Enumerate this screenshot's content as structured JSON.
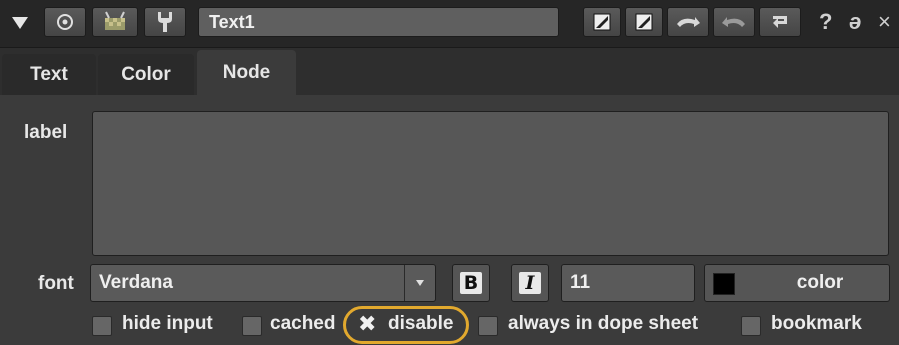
{
  "titlebar": {
    "node_name": "Text1",
    "icons": [
      "collapse-arrow-icon",
      "center-icon",
      "random-color-icon",
      "wrench-icon",
      "undo-icon",
      "redo-icon",
      "revert-icon",
      "help-icon",
      "float-icon",
      "close-icon"
    ],
    "help_glyph": "?",
    "float_glyph": "ə",
    "close_glyph": "×"
  },
  "tabs": [
    {
      "label": "Text",
      "active": false
    },
    {
      "label": "Color",
      "active": false
    },
    {
      "label": "Node",
      "active": true
    }
  ],
  "label_field": {
    "label": "label",
    "value": ""
  },
  "font_row": {
    "label": "font",
    "font_value": "Verdana",
    "bold_glyph": "B",
    "italic_glyph": "I",
    "size_value": "11",
    "color_label": "color",
    "color_swatch": "#000000"
  },
  "checkboxes": [
    {
      "label": "hide input",
      "checked": false
    },
    {
      "label": "cached",
      "checked": false
    },
    {
      "label": "disable",
      "checked": true,
      "highlighted": true
    },
    {
      "label": "always in dope sheet",
      "checked": false
    },
    {
      "label": "bookmark",
      "checked": false
    }
  ],
  "colors": {
    "highlight_ring": "#e2a92e",
    "panel_bg": "#3b3b3b"
  }
}
